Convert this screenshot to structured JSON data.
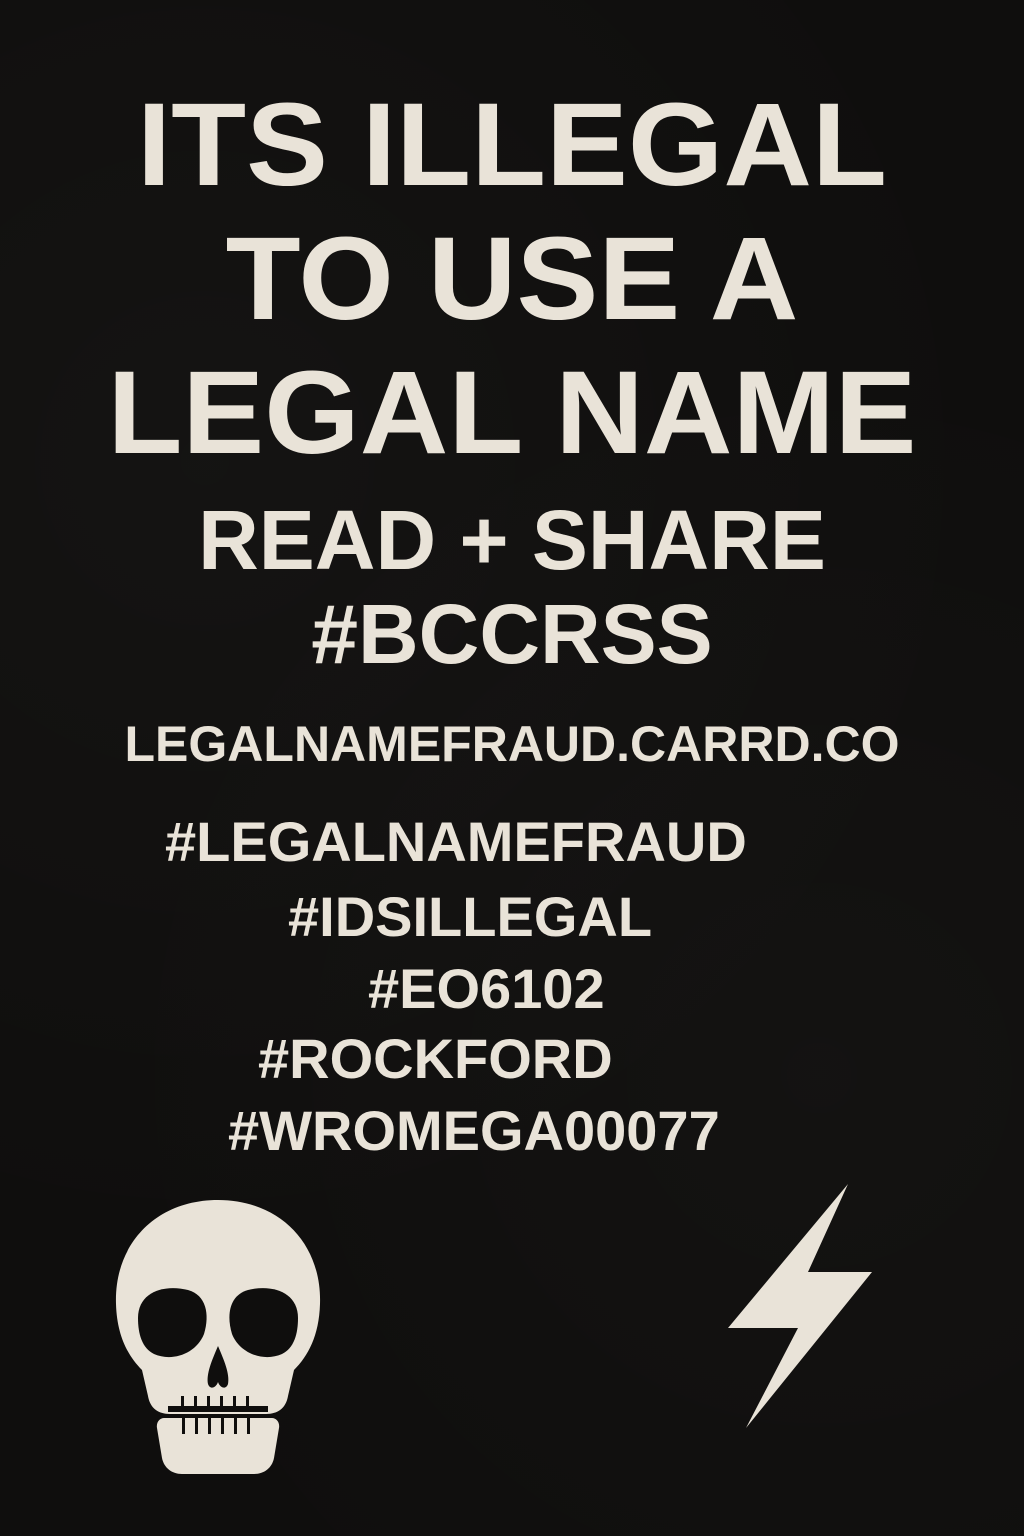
{
  "headline": {
    "line1": "ITS ILLEGAL",
    "line2": "TO USE A",
    "line3": "LEGAL NAME"
  },
  "subheadline": {
    "line1": "READ + SHARE",
    "line2": "#BCCRSS"
  },
  "url": "LEGALNAMEFRAUD.CARRD.CO",
  "hashtags": [
    "#LEGALNAMEFRAUD",
    "#IDSILLEGAL",
    "#EO6102",
    "#ROCKFORD",
    "#WROMEGA00077"
  ],
  "icons": {
    "left": "skull-icon",
    "right": "lightning-bolt-icon"
  },
  "colors": {
    "background": "#0f0e0d",
    "text": "#e9e3d8"
  }
}
